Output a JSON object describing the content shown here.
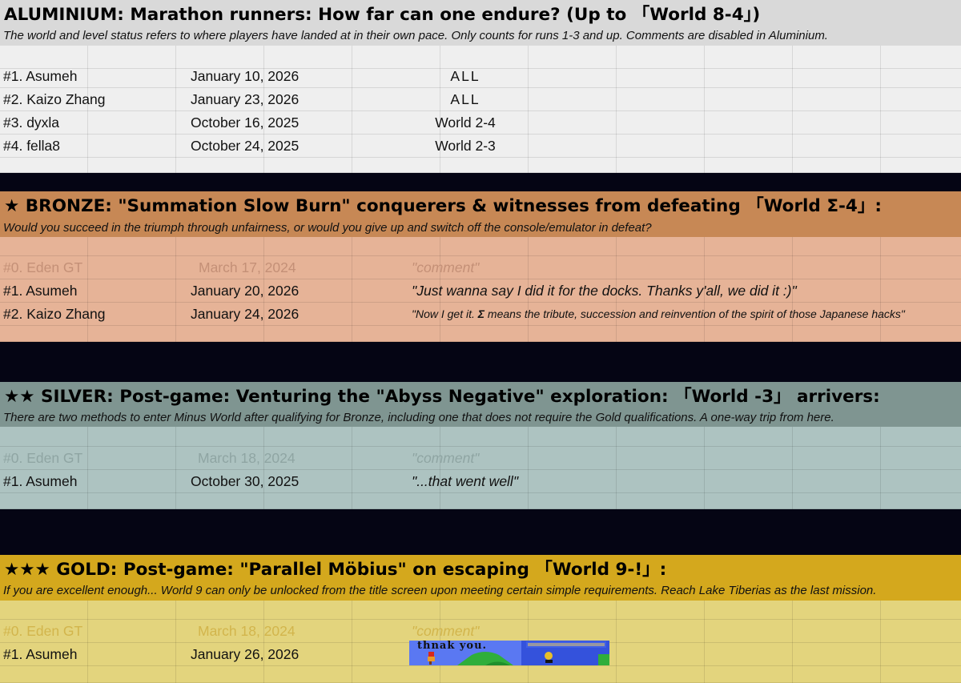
{
  "colors": {
    "aluminium_header_bg": "#d9d9d9",
    "aluminium_rows_bg": "#efefef",
    "bronze_header_bg": "#c78855",
    "bronze_rows_bg": "#e6b397",
    "silver_header_bg": "#7f9591",
    "silver_rows_bg": "#adc3c1",
    "gold_header_bg": "#d4a81d",
    "gold_rows_bg": "#e3d47d",
    "separator_bg": "#050514"
  },
  "aluminium": {
    "title": "ALUMINIUM: Marathon runners: How far can one endure? (Up to 「World 8-4」)",
    "subtitle": "The world and level status refers to where players have landed at in their own pace. Only counts for runs 1-3 and up. Comments are disabled in Aluminium.",
    "rows": [
      {
        "name": "#1. Asumeh",
        "date": "January 10, 2026",
        "status": "ALL"
      },
      {
        "name": "#2. Kaizo Zhang",
        "date": "January 23, 2026",
        "status": "ALL"
      },
      {
        "name": "#3. dyxla",
        "date": "October 16, 2025",
        "status": "World 2-4"
      },
      {
        "name": "#4. fella8",
        "date": "October 24, 2025",
        "status": "World 2-3"
      }
    ]
  },
  "bronze": {
    "title_pre": "★ BRONZE: \"Summation Slow Burn\" conquerers & witnesses from defeating 「World ",
    "title_sigma": "Σ",
    "title_post": "-4」:",
    "subtitle": "Would you succeed in the triumph through unfairness, or would you give up and switch off the console/emulator in defeat?",
    "ghost_row": {
      "name": "#0. Eden GT",
      "date": "March 17, 2024",
      "comment": "\"comment\""
    },
    "rows": [
      {
        "name": "#1. Asumeh",
        "date": "January 20, 2026",
        "comment": "\"Just wanna say I did it for the docks. Thanks y'all, we did it :)\""
      },
      {
        "name": "#2. Kaizo Zhang",
        "date": "January 24, 2026",
        "comment_pre": "\"Now I get it. ",
        "comment_sigma": "Σ",
        "comment_post": " means the tribute, succession and reinvention of the spirit of those Japanese hacks\""
      }
    ]
  },
  "silver": {
    "title": "★★ SILVER: Post-game: Venturing the \"Abyss Negative\" exploration: 「World -3」 arrivers:",
    "subtitle": "There are two methods to enter Minus World after qualifying for Bronze, including one that does not require the Gold qualifications. A one-way trip from here.",
    "ghost_row": {
      "name": "#0. Eden GT",
      "date": "March 18, 2024",
      "comment": "\"comment\""
    },
    "rows": [
      {
        "name": "#1. Asumeh",
        "date": "October 30, 2025",
        "comment": "\"...that went well\""
      }
    ]
  },
  "gold": {
    "title": "★★★ GOLD: Post-game: \"Parallel Möbius\" on escaping 「World 9-!」:",
    "subtitle": "If you are excellent enough... World 9 can only be unlocked from the title screen upon meeting certain simple requirements. Reach Lake Tiberias as the last mission.",
    "ghost_row": {
      "name": "#0. Eden GT",
      "date": "March 18, 2024",
      "comment": "\"comment\""
    },
    "rows": [
      {
        "name": "#1. Asumeh",
        "date": "January 26, 2026"
      }
    ],
    "image_caption": "thnak you."
  }
}
